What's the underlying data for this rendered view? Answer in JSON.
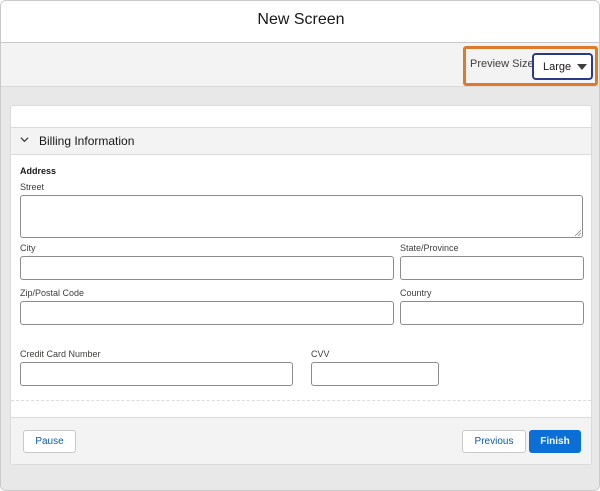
{
  "header": {
    "title": "New Screen"
  },
  "toolbar": {
    "preview_size_label": "Preview Size",
    "preview_size_value": "Large",
    "highlight_color": "#dd7a2b"
  },
  "section": {
    "title": "Billing Information",
    "chevron_icon": "chevron-down-icon"
  },
  "address": {
    "group_label": "Address",
    "street_label": "Street",
    "city_label": "City",
    "state_label": "State/Province",
    "zip_label": "Zip/Postal Code",
    "country_label": "Country"
  },
  "payment": {
    "card_number_label": "Credit Card Number",
    "cvv_label": "CVV"
  },
  "footer": {
    "pause_label": "Pause",
    "previous_label": "Previous",
    "finish_label": "Finish"
  },
  "colors": {
    "brand": "#0b6fd6",
    "select_border": "#2d3b87"
  }
}
